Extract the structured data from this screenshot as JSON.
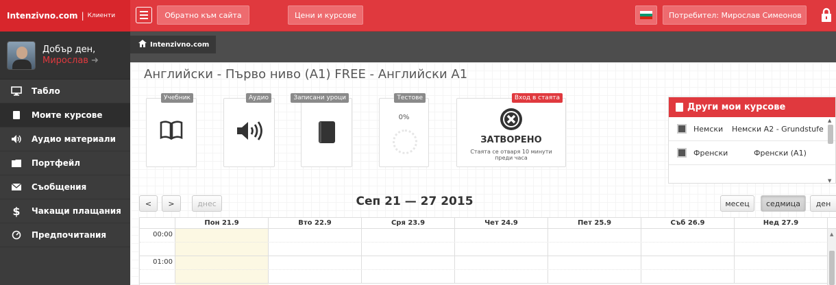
{
  "brand": {
    "name": "Intenzivno.com",
    "separator": "|",
    "sub": "Клиенти"
  },
  "topbar": {
    "back_to_site": "Обратно към сайта",
    "prices": "Цени и курсове",
    "user_label": "Потребител: Мирослав Симеонов"
  },
  "profile": {
    "greeting": "Добър ден,",
    "name": "Мирослав"
  },
  "sidebar": {
    "items": [
      {
        "label": "Табло",
        "icon": "monitor-icon"
      },
      {
        "label": "Моите курсове",
        "icon": "book-icon",
        "active": true
      },
      {
        "label": "Аудио материали",
        "icon": "speaker-icon"
      },
      {
        "label": "Портфейл",
        "icon": "folder-icon"
      },
      {
        "label": "Съобщения",
        "icon": "envelope-icon"
      },
      {
        "label": "Чакащи плащания",
        "icon": "dollar-icon"
      },
      {
        "label": "Предпочитания",
        "icon": "gauge-icon"
      }
    ]
  },
  "breadcrumb": {
    "home": "Intenzivno.com"
  },
  "page": {
    "title": "Английски - Първо ниво (A1) FREE - Английски A1"
  },
  "cards": {
    "textbook": "Учебник",
    "audio": "Аудио",
    "recorded": "Записани уроци",
    "tests": "Тестове",
    "tests_progress": "0%",
    "room": "Вход в стаята",
    "room_status": "ЗАТВОРЕНО",
    "room_note": "Стаята се отваря 10 минути преди часа"
  },
  "other_courses": {
    "title": "Други мои курсове",
    "items": [
      {
        "lang": "Немски",
        "course": "Немски A2 - Grundstufe"
      },
      {
        "lang": "Френски",
        "course": "Френски (A1)"
      }
    ]
  },
  "calendar": {
    "prev": "<",
    "next": ">",
    "today": "днес",
    "title": "Сеп 21 — 27 2015",
    "view_month": "месец",
    "view_week": "седмица",
    "view_day": "ден",
    "days": [
      "Пон 21.9",
      "Вто 22.9",
      "Сря 23.9",
      "Чет 24.9",
      "Пет 25.9",
      "Съб 26.9",
      "Нед 27.9"
    ],
    "times": [
      "00:00",
      "01:00"
    ]
  },
  "colors": {
    "accent": "#e0393e",
    "sidebar_bg": "#3c3c3c",
    "today_highlight": "#fcf8e3"
  }
}
